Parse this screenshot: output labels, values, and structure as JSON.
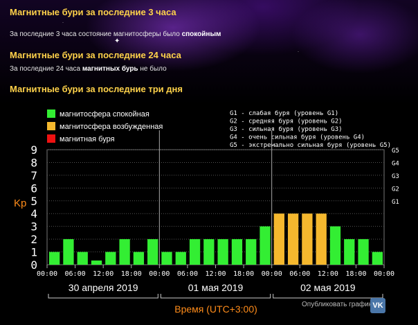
{
  "sections": [
    {
      "title": "Магнитные бури за последние 3 часа",
      "text_prefix": "За последние 3 часа состояние магнитосферы было ",
      "text_bold": "спокойным",
      "text_suffix": ""
    },
    {
      "title": "Магнитные бури за последние 24 часа",
      "text_prefix": "За последние 24 часа ",
      "text_bold": "магнитных бурь",
      "text_suffix": " не было"
    },
    {
      "title": "Магнитные бури за последние три дня"
    }
  ],
  "share_label": "Опубликовать график:",
  "share_icon": "vk-icon",
  "colors": {
    "quiet": "#33ee33",
    "active": "#f5b82e",
    "storm": "#ee1111",
    "orange_text": "#ff8c1a",
    "grid": "#555555"
  },
  "chart_data": {
    "type": "bar",
    "ylabel": "Kp",
    "xlabel": "Время (UTC+3:00)",
    "ylim": [
      0,
      9
    ],
    "y_ticks": [
      "0",
      "1",
      "2",
      "3",
      "4",
      "5",
      "6",
      "7",
      "8",
      "9"
    ],
    "g_scale": [
      {
        "label": "G1",
        "kp": 5
      },
      {
        "label": "G2",
        "kp": 6
      },
      {
        "label": "G3",
        "kp": 7
      },
      {
        "label": "G4",
        "kp": 8
      },
      {
        "label": "G5",
        "kp": 9
      }
    ],
    "legend_left": [
      {
        "label": "магнитосфера спокойная",
        "color": "#33ee33"
      },
      {
        "label": "магнитосфера возбужденная",
        "color": "#f5b82e"
      },
      {
        "label": "магнитная буря",
        "color": "#ee1111"
      }
    ],
    "legend_right": [
      "G1 - слабая буря (уровень G1)",
      "G2 - средняя буря (уровень G2)",
      "G3 - сильная буря (уровень G3)",
      "G4 - очень сильная буря (уровень G4)",
      "G5 - экстремально сильная буря (уровень G5)"
    ],
    "days": [
      {
        "label": "30 апреля 2019",
        "time_ticks": [
          "00:00",
          "06:00",
          "12:00",
          "18:00"
        ],
        "values": [
          1,
          2,
          1,
          0.33,
          1,
          2,
          1,
          2
        ]
      },
      {
        "label": "01 мая 2019",
        "time_ticks": [
          "00:00",
          "06:00",
          "12:00",
          "18:00"
        ],
        "values": [
          1,
          1,
          2,
          2,
          2,
          2,
          2,
          3
        ]
      },
      {
        "label": "02 мая 2019",
        "time_ticks": [
          "00:00",
          "06:00",
          "12:00",
          "18:00"
        ],
        "values": [
          4,
          4,
          4,
          4,
          3,
          2,
          2,
          1
        ]
      }
    ],
    "end_tick": "00:00",
    "grid": true,
    "legend_position": "top"
  }
}
